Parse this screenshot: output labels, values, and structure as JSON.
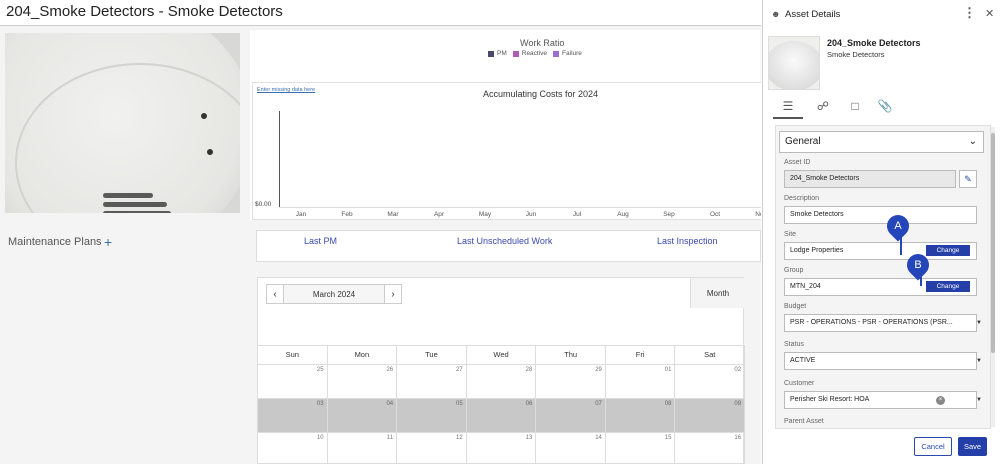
{
  "page": {
    "title": "204_Smoke Detectors - Smoke Detectors",
    "maintenance_plans": "Maintenance Plans",
    "add_icon": "plus-icon"
  },
  "work_ratio": {
    "title": "Work Ratio",
    "legend": [
      {
        "label": "PM",
        "color": "#4a4a6a"
      },
      {
        "label": "Reactive",
        "color": "#b05cb0"
      },
      {
        "label": "Failure",
        "color": "#9b6fd0"
      }
    ]
  },
  "chart_data": {
    "type": "line",
    "title": "Accumulating Costs for 2024",
    "categories": [
      "Jan",
      "Feb",
      "Mar",
      "Apr",
      "May",
      "Jun",
      "Jul",
      "Aug",
      "Sep",
      "Oct",
      "Nov"
    ],
    "y_tick_labels": [
      "$0.00"
    ],
    "series": [],
    "grid": false,
    "annotation": "Enter missing data here"
  },
  "last_links": {
    "last_pm": "Last PM",
    "last_unscheduled": "Last Unscheduled Work",
    "last_inspection": "Last Inspection"
  },
  "calendar": {
    "month_label": "March 2024",
    "view": "Month",
    "prev_icon": "chevron-left-icon",
    "next_icon": "chevron-right-icon",
    "weekdays": [
      "Sun",
      "Mon",
      "Tue",
      "Wed",
      "Thu",
      "Fri",
      "Sat"
    ],
    "weeks": [
      [
        "25",
        "26",
        "27",
        "28",
        "29",
        "01",
        "02"
      ],
      [
        "03",
        "04",
        "05",
        "06",
        "07",
        "08",
        "09"
      ],
      [
        "10",
        "11",
        "12",
        "13",
        "14",
        "15",
        "16"
      ]
    ],
    "shaded_week_index": 1
  },
  "panel": {
    "title": "Asset Details",
    "user_icon": "user-icon",
    "menu_icon": "more-vertical-icon",
    "close_icon": "close-icon",
    "asset_name": "204_Smoke Detectors",
    "asset_description": "Smoke Detectors",
    "tabs": [
      "details-tab-icon",
      "hierarchy-tab-icon",
      "notes-tab-icon",
      "attachments-tab-icon"
    ],
    "section": "General",
    "fields": {
      "asset_id_label": "Asset ID",
      "asset_id_value": "204_Smoke Detectors",
      "description_label": "Description",
      "description_value": "Smoke Detectors",
      "site_label": "Site",
      "site_value": "Lodge Properties",
      "group_label": "Group",
      "group_value": "MTN_204",
      "change_label": "Change",
      "budget_label": "Budget",
      "budget_value": "PSR - OPERATIONS - PSR - OPERATIONS (PSR...",
      "status_label": "Status",
      "status_value": "ACTIVE",
      "customer_label": "Customer",
      "customer_value": "Perisher Ski Resort: HOA",
      "parent_label": "Parent Asset"
    },
    "cancel": "Cancel",
    "save": "Save",
    "marker_a": "A",
    "marker_b": "B",
    "marker_color": "#2546b8"
  }
}
